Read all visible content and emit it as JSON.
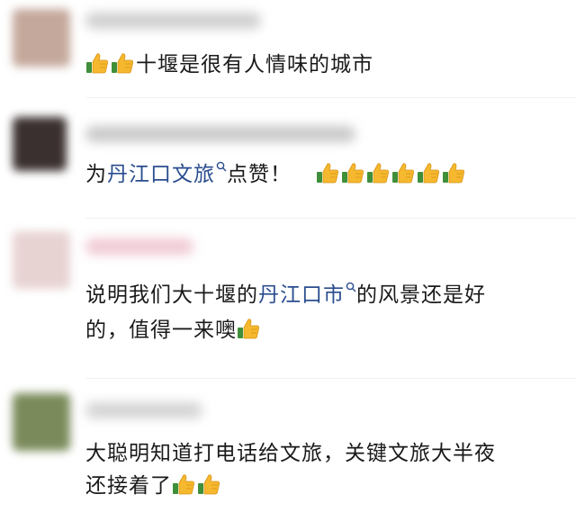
{
  "comments": [
    {
      "text_before": "十堰是很有人情味的城市",
      "colors": {
        "avatar": "#c4a89b",
        "name": "#cfcfcf"
      }
    },
    {
      "prefix": "为",
      "link": "丹江口文旅",
      "suffix": "点赞！",
      "colors": {
        "avatar": "#3a3030",
        "name": "#c9c9c9"
      }
    },
    {
      "line1_prefix": "说明我们大十堰的",
      "link": "丹江口市",
      "line1_suffix": "的风景还是好",
      "line2": "的，值得一来噢",
      "colors": {
        "avatar": "#e8d3d3",
        "name": "#f0c9d3"
      }
    },
    {
      "line1": "大聪明知道打电话给文旅，关键文旅大半夜",
      "line2": "还接着了",
      "colors": {
        "avatar": "#7a8a5a",
        "name": "#d4d4d4"
      }
    }
  ],
  "icons": {
    "thumb": "thumbs-up-icon",
    "search": "search-icon"
  }
}
